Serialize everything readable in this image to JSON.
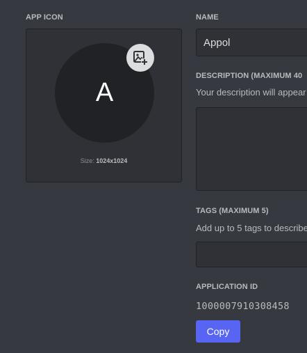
{
  "app_icon": {
    "label": "APP ICON",
    "avatar_letter": "A",
    "size_prefix": "Size: ",
    "size_value": "1024x1024",
    "upload_icon": "add-image-icon"
  },
  "name": {
    "label": "NAME",
    "value": "Appol"
  },
  "description": {
    "label": "DESCRIPTION (MAXIMUM 40",
    "helper": "Your description will appear",
    "value": ""
  },
  "tags": {
    "label": "TAGS (MAXIMUM 5)",
    "helper": "Add up to 5 tags to describe",
    "value": ""
  },
  "application_id": {
    "label": "APPLICATION ID",
    "value": "1000007910308458",
    "copy_label": "Copy"
  },
  "colors": {
    "background": "#36393f",
    "panel": "#2f3136",
    "border": "#202225",
    "accent": "#5865f2"
  }
}
